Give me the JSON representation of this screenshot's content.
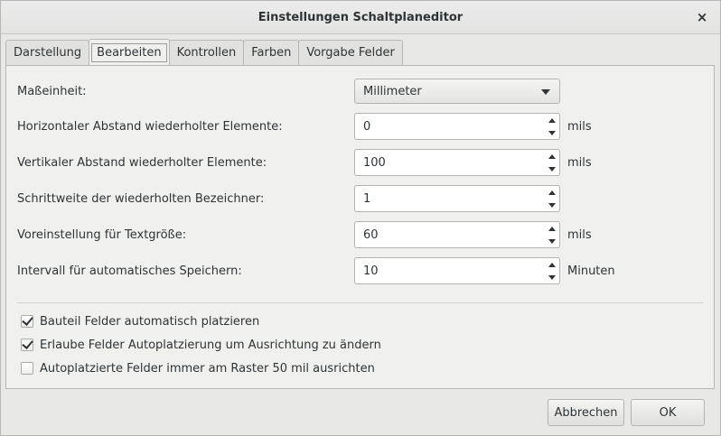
{
  "window": {
    "title": "Einstellungen Schaltplaneditor",
    "close_icon": "×"
  },
  "tabs": [
    {
      "label": "Darstellung"
    },
    {
      "label": "Bearbeiten"
    },
    {
      "label": "Kontrollen"
    },
    {
      "label": "Farben"
    },
    {
      "label": "Vorgabe Felder"
    }
  ],
  "active_tab": "Bearbeiten",
  "fields": {
    "unit": {
      "label": "Maßeinheit:",
      "value": "Millimeter"
    },
    "h_spacing": {
      "label": "Horizontaler Abstand wiederholter Elemente:",
      "value": "0",
      "unit": "mils"
    },
    "v_spacing": {
      "label": "Vertikaler Abstand wiederholter Elemente:",
      "value": "100",
      "unit": "mils"
    },
    "label_step": {
      "label": "Schrittweite der wiederholten Bezeichner:",
      "value": "1"
    },
    "text_size": {
      "label": "Voreinstellung für Textgröße:",
      "value": "60",
      "unit": "mils"
    },
    "autosave": {
      "label": "Intervall für automatisches Speichern:",
      "value": "10",
      "unit": "Minuten"
    }
  },
  "checks": [
    {
      "label": "Bauteil Felder automatisch platzieren",
      "checked": true
    },
    {
      "label": "Erlaube Felder Autoplatzierung um Ausrichtung zu ändern",
      "checked": true
    },
    {
      "label": "Autoplatzierte Felder immer am Raster 50 mil ausrichten",
      "checked": false
    }
  ],
  "buttons": {
    "cancel": "Abbrechen",
    "ok": "OK"
  }
}
